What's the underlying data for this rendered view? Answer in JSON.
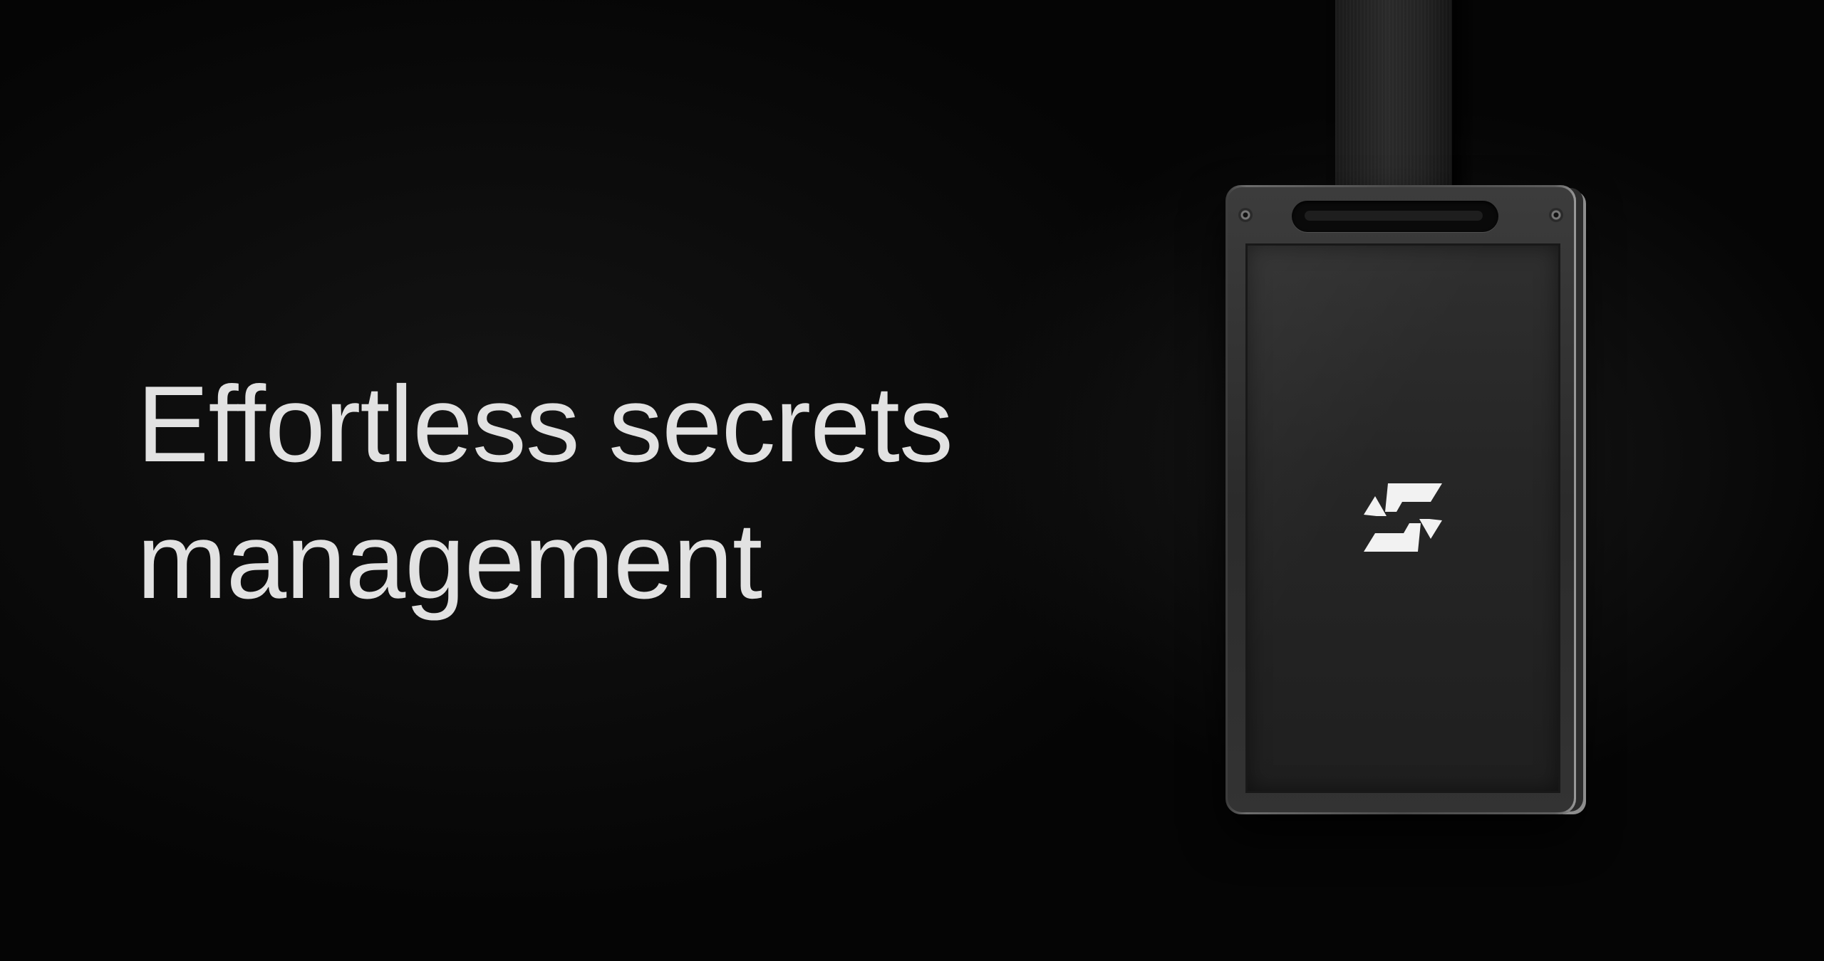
{
  "hero": {
    "headline_line1": "Effortless secrets",
    "headline_line2": "management"
  },
  "badge": {
    "logo_icon": "brand-logo-icon",
    "strap_color": "#222222",
    "frame_color": "#5a5a5a"
  },
  "colors": {
    "background": "#050505",
    "headline": "#e2e2e2",
    "logo": "#f2f2f2"
  }
}
